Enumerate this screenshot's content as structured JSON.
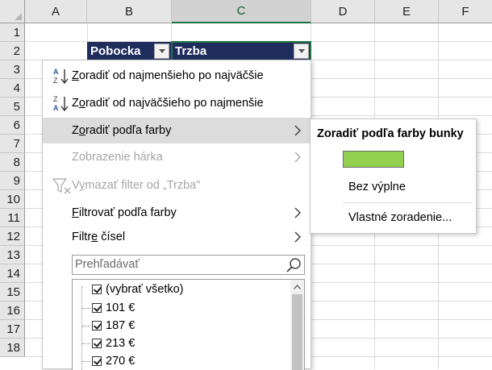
{
  "columns": [
    "A",
    "B",
    "C",
    "D",
    "E",
    "F"
  ],
  "active_column": "C",
  "rows": [
    "1",
    "2",
    "3",
    "4",
    "5",
    "6",
    "7",
    "8",
    "9",
    "10",
    "11",
    "12",
    "13",
    "14",
    "15",
    "16",
    "17",
    "18"
  ],
  "header_row": {
    "b2": "Pobocka",
    "c2": "Trzba",
    "fill_color": "#1f2d5c"
  },
  "menu": {
    "sort_asc": "Zoradiť od najmenšieho po najväčšie",
    "sort_asc_icon": "sort-ascending-icon",
    "sort_desc": "Zoradiť od najväčšieho po najmenšie",
    "sort_desc_icon": "sort-descending-icon",
    "sort_by_color": "Zoradiť podľa farby",
    "sheet_view": "Zobrazenie hárka",
    "clear_filter": "Vymazať filter od „Trzba\"",
    "filter_by_color": "Filtrovať podľa farby",
    "number_filters": "Filtre čísel",
    "search_placeholder": "Prehľadávať",
    "items": [
      "(vybrať všetko)",
      "101 €",
      "187 €",
      "213 €",
      "270 €"
    ]
  },
  "submenu": {
    "title": "Zoradiť podľa farby bunky",
    "swatch_color": "#92d050",
    "no_fill": "Bez výplne",
    "custom_sort": "Vlastné zoradenie..."
  }
}
